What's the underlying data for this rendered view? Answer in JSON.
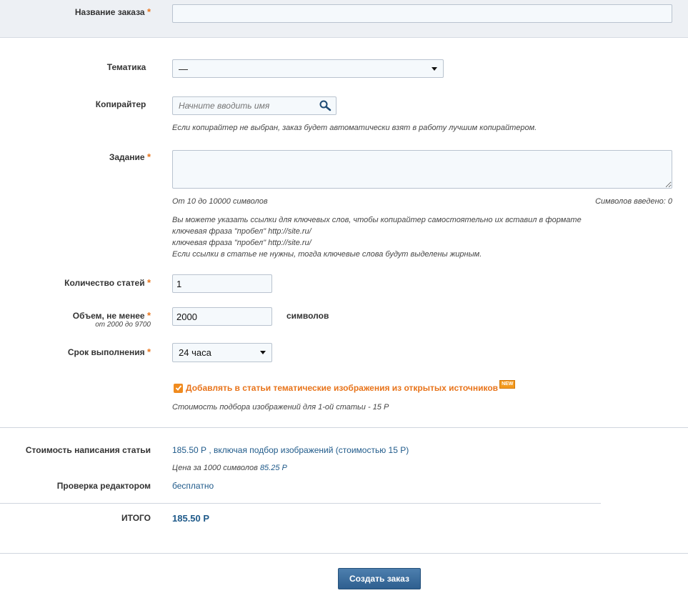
{
  "order_name": {
    "label": "Название заказа",
    "required": "*",
    "value": ""
  },
  "topic": {
    "label": "Тематика",
    "selected": "—"
  },
  "copywriter": {
    "label": "Копирайтер",
    "placeholder": "Начните вводить имя",
    "hint": "Если копирайтер не выбран, заказ будет автоматически взят в работу лучшим копирайтером."
  },
  "task": {
    "label": "Задание",
    "required": "*",
    "range_hint": "От 10 до 10000 символов",
    "chars_entered": "Символов введено: 0",
    "help": [
      "Вы можете указать ссылки для ключевых слов, чтобы копирайтер самостоятельно их вставил в формате",
      "ключевая фраза \"пробел\" http://site.ru/",
      "ключевая фраза \"пробел\" http://site.ru/",
      "Если ссылки в статье не нужны, тогда ключевые слова будут выделены жирным."
    ]
  },
  "articles_count": {
    "label": "Количество статей",
    "required": "*",
    "value": "1"
  },
  "volume": {
    "label": "Объем, не менее",
    "required": "*",
    "sublabel": "от 2000 до 9700",
    "value": "2000",
    "unit": "символов"
  },
  "deadline": {
    "label": "Срок выполнения",
    "required": "*",
    "selected": "24 часа"
  },
  "images": {
    "checked": true,
    "label": "Добавлять в статьи тематические изображения из открытых источников",
    "badge": "NEW",
    "hint": "Стоимость подбора изображений для 1-ой статьи - 15 Р"
  },
  "pricing": {
    "article_cost_label": "Стоимость написания статьи",
    "article_cost_value": "185.50 Р , включая подбор изображений (стоимостью 15 Р)",
    "per_1000_label": "Цена за 1000 символов",
    "per_1000_value": "85.25 Р",
    "editor_label": "Проверка редактором",
    "editor_value": "бесплатно",
    "total_label": "ИТОГО",
    "total_value": "185.50 Р"
  },
  "submit_label": "Создать заказ",
  "colors": {
    "accent": "#e8741b",
    "link": "#1f5a8a",
    "button": "#2e5f8f"
  }
}
